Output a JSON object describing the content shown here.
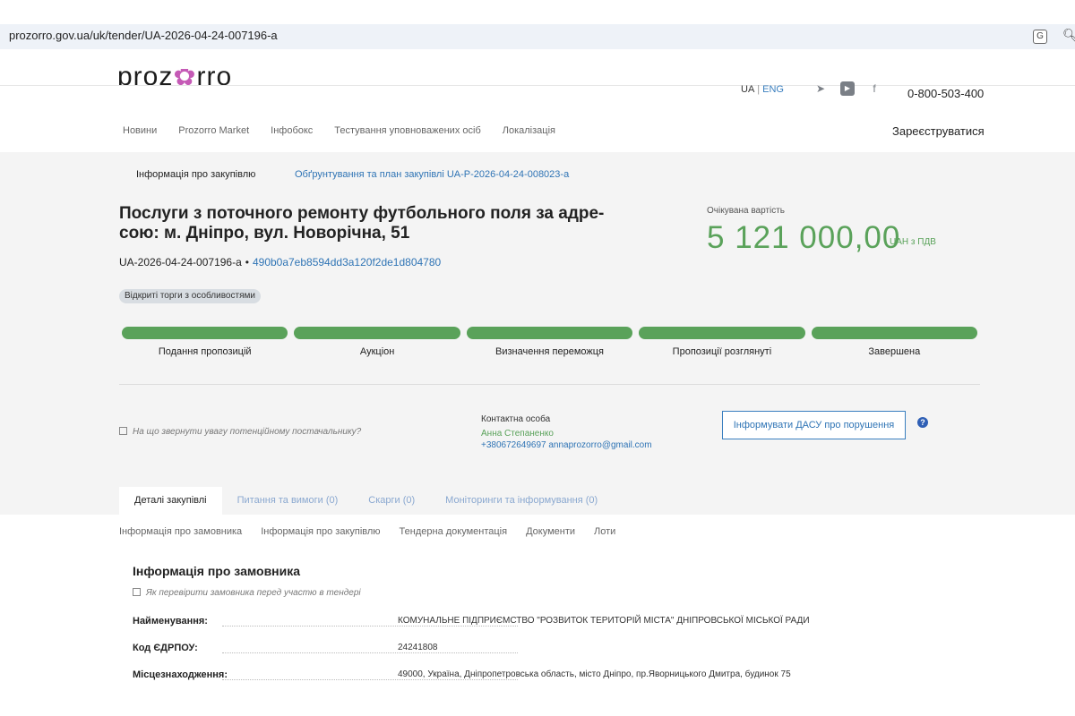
{
  "browser": {
    "url": "prozorro.gov.ua/uk/tender/UA-2026-04-24-007196-a"
  },
  "header": {
    "logo": "prozorro",
    "lang_ua": "UA",
    "lang_eng": "ENG",
    "phone": "0-800-503-400",
    "nav": [
      "Новини",
      "Prozorro Market",
      "Інфобокс",
      "Тестування уповноважених осіб",
      "Локалізація"
    ],
    "register": "Зареєструватися"
  },
  "tender": {
    "subnav_info": "Інформація про закупівлю",
    "subnav_link": "Обґрунтування та план закупівлі UA-P-2026-04-24-008023-a",
    "title": "Послуги з поточного ремонту футбольного поля за адре-сою: м. Дніпро, вул. Новорічна, 51",
    "id": "UA-2026-04-24-007196-a",
    "hash": "490b0a7eb8594dd3a120f2de1d804780",
    "badge": "Відкриті торги з особливостями",
    "expected_label": "Очікувана вартість",
    "expected_value": "5 121 000,00",
    "expected_suffix": "UAH з ПДВ",
    "stages": [
      {
        "label": "Подання пропозицій",
        "progress": 1
      },
      {
        "label": "Аукціон",
        "progress": 1
      },
      {
        "label": "Визначення переможця",
        "progress": 1
      },
      {
        "label": "Пропозиції розглянуті",
        "progress": 1
      },
      {
        "label": "Завершена",
        "progress": 1
      }
    ],
    "attention": "На що звернути увагу потенційному постачальнику?",
    "contact_label": "Контактна особа",
    "contact_name": "Анна Степаненко",
    "contact_tel": "+380672649697 annaprozorro@gmail.com",
    "dasu_button": "Інформувати ДАСУ про порушення",
    "help": "?"
  },
  "tabs": [
    {
      "label": "Деталі закупівлі",
      "active": true
    },
    {
      "label": "Питання та вимоги (0)",
      "active": false
    },
    {
      "label": "Скарги (0)",
      "active": false
    },
    {
      "label": "Моніторинги та інформування (0)",
      "active": false
    }
  ],
  "sublinks": [
    "Інформація про замовника",
    "Інформація про закупівлю",
    "Тендерна документація",
    "Документи",
    "Лоти"
  ],
  "customer": {
    "title": "Інформація про замовника",
    "hint": "Як перевірити замовника перед участю в тендері",
    "rows": [
      {
        "key": "Найменування:",
        "value": "КОМУНАЛЬНЕ ПІДПРИЄМСТВО \"РОЗВИТОК ТЕРИТОРІЙ МІСТА\" ДНІПРОВСЬКОЇ МІСЬКОЇ РАДИ"
      },
      {
        "key": "Код ЄДРПОУ:",
        "value": "24241808"
      },
      {
        "key": "Місцезнаходження:",
        "value": "49000, Україна, Дніпропетровська область, місто Дніпро, пр.Яворницького Дмитра, будинок 75"
      }
    ]
  }
}
